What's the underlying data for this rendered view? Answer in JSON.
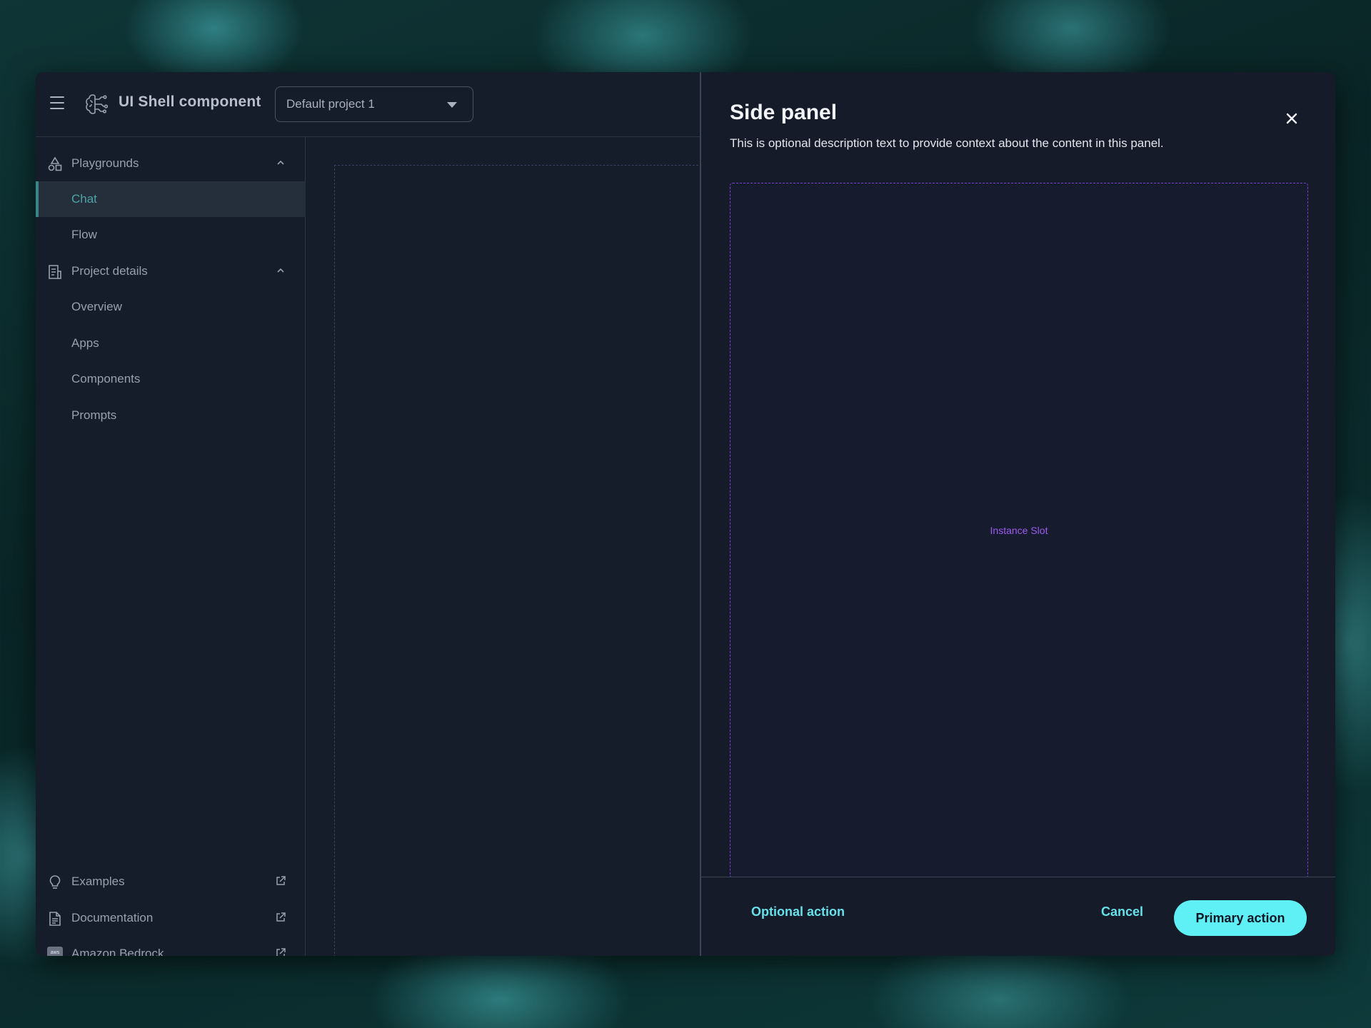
{
  "header": {
    "app_title": "UI Shell component",
    "project_select": {
      "value": "Default project 1"
    }
  },
  "sidebar": {
    "sections": [
      {
        "label": "Playgrounds",
        "icon": "shapes-icon",
        "expanded": true,
        "items": [
          {
            "label": "Chat",
            "active": true
          },
          {
            "label": "Flow",
            "active": false
          }
        ]
      },
      {
        "label": "Project details",
        "icon": "document-list-icon",
        "expanded": true,
        "items": [
          {
            "label": "Overview"
          },
          {
            "label": "Apps"
          },
          {
            "label": "Components"
          },
          {
            "label": "Prompts"
          }
        ]
      }
    ],
    "footer_links": [
      {
        "label": "Examples",
        "icon": "lightbulb-icon"
      },
      {
        "label": "Documentation",
        "icon": "document-icon"
      },
      {
        "label": "Amazon Bedrock",
        "icon": "aws-icon",
        "icon_text": "aws"
      }
    ]
  },
  "side_panel": {
    "title": "Side panel",
    "description": "This is optional description text to provide context about the content in this panel.",
    "slot_label": "Instance Slot",
    "footer": {
      "optional_action": "Optional action",
      "cancel": "Cancel",
      "primary_action": "Primary action"
    }
  },
  "colors": {
    "accent": "#5ef0f4",
    "active_nav": "#4da3a7",
    "slot_border": "#7a3fd6"
  }
}
